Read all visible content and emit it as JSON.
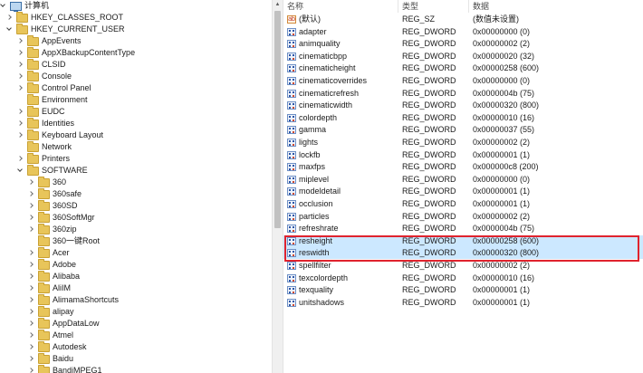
{
  "tree": {
    "root": "计算机",
    "nodes": [
      {
        "label": "HKEY_CLASSES_ROOT",
        "level": 1,
        "expand": "right"
      },
      {
        "label": "HKEY_CURRENT_USER",
        "level": 1,
        "expand": "down"
      },
      {
        "label": "AppEvents",
        "level": 2,
        "expand": "right"
      },
      {
        "label": "AppXBackupContentType",
        "level": 2,
        "expand": "right"
      },
      {
        "label": "CLSID",
        "level": 2,
        "expand": "right"
      },
      {
        "label": "Console",
        "level": 2,
        "expand": "right"
      },
      {
        "label": "Control Panel",
        "level": 2,
        "expand": "right"
      },
      {
        "label": "Environment",
        "level": 2,
        "expand": "none"
      },
      {
        "label": "EUDC",
        "level": 2,
        "expand": "right"
      },
      {
        "label": "Identities",
        "level": 2,
        "expand": "right"
      },
      {
        "label": "Keyboard Layout",
        "level": 2,
        "expand": "right"
      },
      {
        "label": "Network",
        "level": 2,
        "expand": "none"
      },
      {
        "label": "Printers",
        "level": 2,
        "expand": "right"
      },
      {
        "label": "SOFTWARE",
        "level": 2,
        "expand": "down"
      },
      {
        "label": "360",
        "level": 3,
        "expand": "right"
      },
      {
        "label": "360safe",
        "level": 3,
        "expand": "right"
      },
      {
        "label": "360SD",
        "level": 3,
        "expand": "right"
      },
      {
        "label": "360SoftMgr",
        "level": 3,
        "expand": "right"
      },
      {
        "label": "360zip",
        "level": 3,
        "expand": "right"
      },
      {
        "label": "360一键Root",
        "level": 3,
        "expand": "none"
      },
      {
        "label": "Acer",
        "level": 3,
        "expand": "right"
      },
      {
        "label": "Adobe",
        "level": 3,
        "expand": "right"
      },
      {
        "label": "Alibaba",
        "level": 3,
        "expand": "right"
      },
      {
        "label": "AliIM",
        "level": 3,
        "expand": "right"
      },
      {
        "label": "AlimamaShortcuts",
        "level": 3,
        "expand": "right"
      },
      {
        "label": "alipay",
        "level": 3,
        "expand": "right"
      },
      {
        "label": "AppDataLow",
        "level": 3,
        "expand": "right"
      },
      {
        "label": "Atmel",
        "level": 3,
        "expand": "right"
      },
      {
        "label": "Autodesk",
        "level": 3,
        "expand": "right"
      },
      {
        "label": "Baidu",
        "level": 3,
        "expand": "right"
      },
      {
        "label": "BandiMPEG1",
        "level": 3,
        "expand": "right"
      }
    ]
  },
  "list": {
    "headers": {
      "name": "名称",
      "type": "类型",
      "data": "数据"
    },
    "rows": [
      {
        "name": "(默认)",
        "type": "REG_SZ",
        "data": "(数值未设置)",
        "icon": "string-value-icon",
        "selected": false
      },
      {
        "name": "adapter",
        "type": "REG_DWORD",
        "data": "0x00000000 (0)",
        "icon": "binary-value-icon",
        "selected": false
      },
      {
        "name": "animquality",
        "type": "REG_DWORD",
        "data": "0x00000002 (2)",
        "icon": "binary-value-icon",
        "selected": false
      },
      {
        "name": "cinematicbpp",
        "type": "REG_DWORD",
        "data": "0x00000020 (32)",
        "icon": "binary-value-icon",
        "selected": false
      },
      {
        "name": "cinematicheight",
        "type": "REG_DWORD",
        "data": "0x00000258 (600)",
        "icon": "binary-value-icon",
        "selected": false
      },
      {
        "name": "cinematicoverrides",
        "type": "REG_DWORD",
        "data": "0x00000000 (0)",
        "icon": "binary-value-icon",
        "selected": false
      },
      {
        "name": "cinematicrefresh",
        "type": "REG_DWORD",
        "data": "0x0000004b (75)",
        "icon": "binary-value-icon",
        "selected": false
      },
      {
        "name": "cinematicwidth",
        "type": "REG_DWORD",
        "data": "0x00000320 (800)",
        "icon": "binary-value-icon",
        "selected": false
      },
      {
        "name": "colordepth",
        "type": "REG_DWORD",
        "data": "0x00000010 (16)",
        "icon": "binary-value-icon",
        "selected": false
      },
      {
        "name": "gamma",
        "type": "REG_DWORD",
        "data": "0x00000037 (55)",
        "icon": "binary-value-icon",
        "selected": false
      },
      {
        "name": "lights",
        "type": "REG_DWORD",
        "data": "0x00000002 (2)",
        "icon": "binary-value-icon",
        "selected": false
      },
      {
        "name": "lockfb",
        "type": "REG_DWORD",
        "data": "0x00000001 (1)",
        "icon": "binary-value-icon",
        "selected": false
      },
      {
        "name": "maxfps",
        "type": "REG_DWORD",
        "data": "0x000000c8 (200)",
        "icon": "binary-value-icon",
        "selected": false
      },
      {
        "name": "miplevel",
        "type": "REG_DWORD",
        "data": "0x00000000 (0)",
        "icon": "binary-value-icon",
        "selected": false
      },
      {
        "name": "modeldetail",
        "type": "REG_DWORD",
        "data": "0x00000001 (1)",
        "icon": "binary-value-icon",
        "selected": false
      },
      {
        "name": "occlusion",
        "type": "REG_DWORD",
        "data": "0x00000001 (1)",
        "icon": "binary-value-icon",
        "selected": false
      },
      {
        "name": "particles",
        "type": "REG_DWORD",
        "data": "0x00000002 (2)",
        "icon": "binary-value-icon",
        "selected": false
      },
      {
        "name": "refreshrate",
        "type": "REG_DWORD",
        "data": "0x0000004b (75)",
        "icon": "binary-value-icon",
        "selected": false
      },
      {
        "name": "resheight",
        "type": "REG_DWORD",
        "data": "0x00000258 (600)",
        "icon": "binary-value-icon",
        "selected": true
      },
      {
        "name": "reswidth",
        "type": "REG_DWORD",
        "data": "0x00000320 (800)",
        "icon": "binary-value-icon",
        "selected": true
      },
      {
        "name": "spellfilter",
        "type": "REG_DWORD",
        "data": "0x00000002 (2)",
        "icon": "binary-value-icon",
        "selected": false
      },
      {
        "name": "texcolordepth",
        "type": "REG_DWORD",
        "data": "0x00000010 (16)",
        "icon": "binary-value-icon",
        "selected": false
      },
      {
        "name": "texquality",
        "type": "REG_DWORD",
        "data": "0x00000001 (1)",
        "icon": "binary-value-icon",
        "selected": false
      },
      {
        "name": "unitshadows",
        "type": "REG_DWORD",
        "data": "0x00000001 (1)",
        "icon": "binary-value-icon",
        "selected": false
      }
    ]
  },
  "colors": {
    "selection": "#cce8ff",
    "highlight_border": "#e0232e",
    "folder": "#e8c55a"
  }
}
